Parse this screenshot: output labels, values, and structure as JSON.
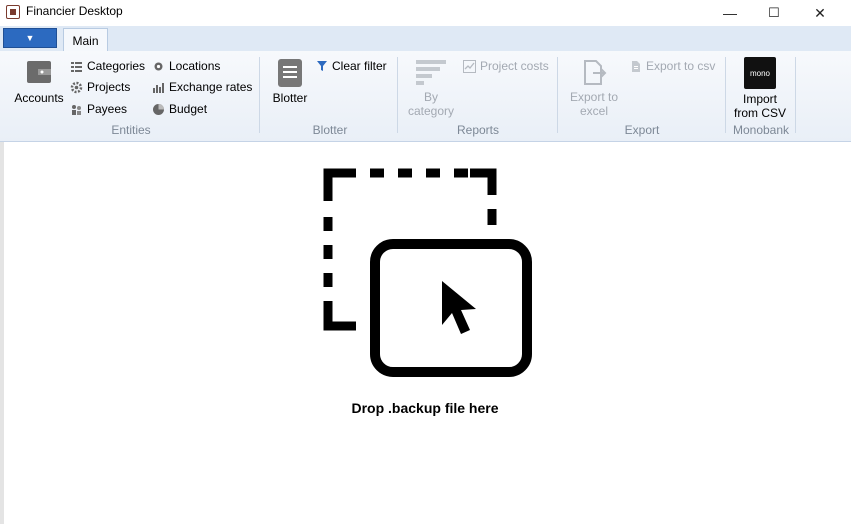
{
  "window": {
    "title": "Financier Desktop",
    "min_glyph": "—",
    "max_glyph": "☐",
    "close_glyph": "✕"
  },
  "ribbon": {
    "app_menu_glyph": "▼",
    "tabs": [
      {
        "label": "Main"
      }
    ],
    "groups": {
      "entities": {
        "label": "Entities",
        "accounts": "Accounts",
        "categories": "Categories",
        "projects": "Projects",
        "payees": "Payees",
        "locations": "Locations",
        "exchange_rates": "Exchange rates",
        "budget": "Budget"
      },
      "blotter": {
        "label": "Blotter",
        "blotter": "Blotter",
        "clear_filter": "Clear filter"
      },
      "reports": {
        "label": "Reports",
        "by_category_1": "By",
        "by_category_2": "category",
        "project_costs": "Project costs"
      },
      "export": {
        "label": "Export",
        "export_excel_1": "Export to",
        "export_excel_2": "excel",
        "export_csv": "Export to csv"
      },
      "monobank": {
        "label": "Monobank",
        "logo_text": "mono",
        "import_1": "Import",
        "import_2": "from CSV"
      }
    }
  },
  "main": {
    "drop_text": "Drop .backup file here"
  },
  "icons": {
    "accounts": "wallet-icon",
    "categories": "list-icon",
    "projects": "gear-icon",
    "payees": "people-icon",
    "locations": "pin-icon",
    "exchange_rates": "bar-chart-icon",
    "budget": "pie-icon",
    "blotter": "document-icon",
    "clear_filter": "filter-icon",
    "by_category": "stacked-bars-icon",
    "project_costs": "line-chart-icon",
    "export_excel": "export-icon",
    "export_csv": "csv-icon",
    "drop": "drag-drop-icon"
  },
  "colors": {
    "accent": "#2c6ac0",
    "ribbon_bg": "#e9eff7",
    "disabled": "#a3a9b2",
    "group_label": "#7d8896"
  }
}
